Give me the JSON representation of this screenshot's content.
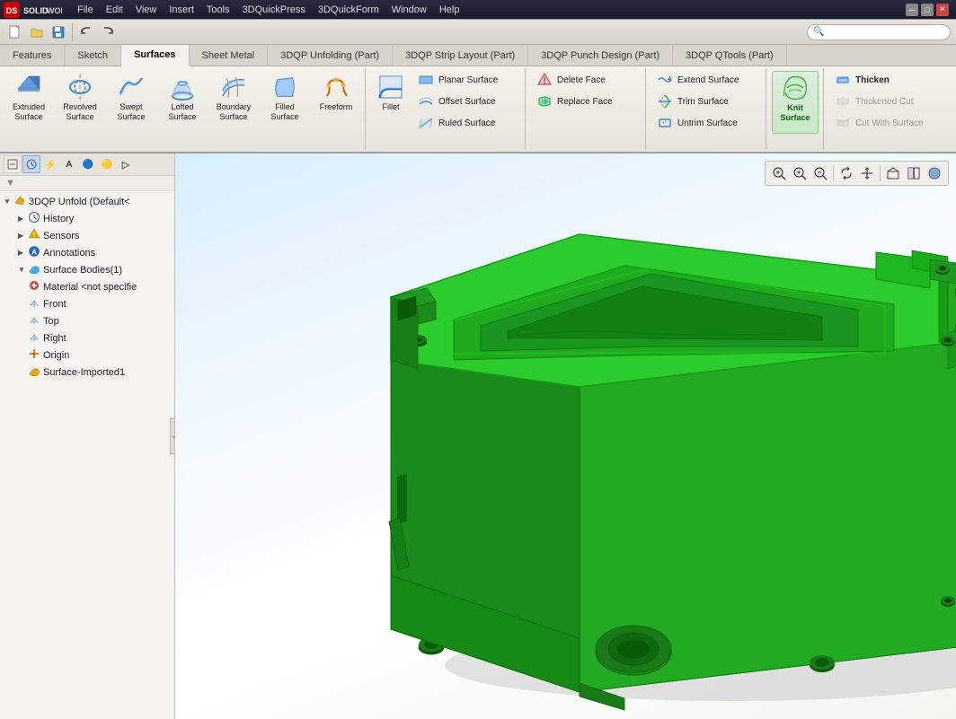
{
  "app": {
    "title": "SOLIDWORKS",
    "logo": "DS SOLIDWORKS"
  },
  "menubar": {
    "items": [
      "File",
      "Edit",
      "View",
      "Insert",
      "Tools",
      "3DQuickPress",
      "3DQuickForm",
      "Window",
      "Help"
    ]
  },
  "ribbon": {
    "tabs": [
      {
        "label": "Features",
        "active": false
      },
      {
        "label": "Sketch",
        "active": false
      },
      {
        "label": "Surfaces",
        "active": true
      },
      {
        "label": "Sheet Metal",
        "active": false
      },
      {
        "label": "3DQP Unfolding (Part)",
        "active": false
      },
      {
        "label": "3DQP Strip Layout (Part)",
        "active": false
      },
      {
        "label": "3DQP Punch Design (Part)",
        "active": false
      },
      {
        "label": "3DQP QTools (Part)",
        "active": false
      }
    ],
    "groups": {
      "surfaces": [
        {
          "id": "extruded",
          "label": "Extruded\nSurface",
          "icon": "extruded-surface-icon"
        },
        {
          "id": "revolved",
          "label": "Revolved\nSurface",
          "icon": "revolved-surface-icon"
        },
        {
          "id": "swept",
          "label": "Swept\nSurface",
          "icon": "swept-surface-icon"
        },
        {
          "id": "lofted",
          "label": "Lofted\nSurface",
          "icon": "lofted-surface-icon"
        },
        {
          "id": "boundary",
          "label": "Boundary\nSurface",
          "icon": "boundary-surface-icon"
        },
        {
          "id": "filled",
          "label": "Filled\nSurface",
          "icon": "filled-surface-icon"
        },
        {
          "id": "freeform",
          "label": "Freeform",
          "icon": "freeform-icon"
        }
      ],
      "modify": [
        {
          "id": "fillet",
          "label": "Fillet",
          "icon": "fillet-icon"
        },
        {
          "id": "planar",
          "label": "Planar Surface",
          "icon": "planar-surface-icon"
        },
        {
          "id": "offset",
          "label": "Offset Surface",
          "icon": "offset-surface-icon"
        },
        {
          "id": "ruled",
          "label": "Ruled Surface",
          "icon": "ruled-surface-icon"
        }
      ],
      "face": [
        {
          "id": "delete-face",
          "label": "Delete Face",
          "icon": "delete-face-icon"
        },
        {
          "id": "replace-face",
          "label": "Replace Face",
          "icon": "replace-face-icon"
        }
      ],
      "extend": [
        {
          "id": "extend-surface",
          "label": "Extend Surface",
          "icon": "extend-surface-icon"
        },
        {
          "id": "trim-surface",
          "label": "Trim Surface",
          "icon": "trim-surface-icon"
        },
        {
          "id": "untrim-surface",
          "label": "Untrim Surface",
          "icon": "untrim-surface-icon"
        }
      ],
      "knit": [
        {
          "id": "knit-surface",
          "label": "Knit\nSurface",
          "icon": "knit-surface-icon"
        }
      ],
      "thicken": [
        {
          "id": "thicken",
          "label": "Thicken",
          "icon": "thicken-icon"
        },
        {
          "id": "thickened-cut",
          "label": "Thickened Cut",
          "icon": "thickened-cut-icon"
        },
        {
          "id": "cut-with-surface",
          "label": "Cut With Surface",
          "icon": "cut-with-surface-icon"
        }
      ]
    }
  },
  "sidebar": {
    "toolbar_buttons": [
      "filter",
      "history",
      "sensors",
      "expand-all",
      "collapse-all",
      "more"
    ],
    "tree": [
      {
        "id": "root",
        "label": "3DQP Unfold  (Default<",
        "icon": "part-icon",
        "level": 0,
        "expandable": true
      },
      {
        "id": "history",
        "label": "History",
        "icon": "history-icon",
        "level": 1
      },
      {
        "id": "sensors",
        "label": "Sensors",
        "icon": "sensor-icon",
        "level": 1
      },
      {
        "id": "annotations",
        "label": "Annotations",
        "icon": "annotation-icon",
        "level": 1,
        "expandable": true
      },
      {
        "id": "surface-bodies",
        "label": "Surface Bodies(1)",
        "icon": "surface-bodies-icon",
        "level": 1,
        "expandable": true
      },
      {
        "id": "material",
        "label": "Material <not specifie",
        "icon": "material-icon",
        "level": 1
      },
      {
        "id": "front",
        "label": "Front",
        "icon": "plane-icon",
        "level": 1
      },
      {
        "id": "top",
        "label": "Top",
        "icon": "plane-icon",
        "level": 1
      },
      {
        "id": "right",
        "label": "Right",
        "icon": "plane-icon",
        "level": 1
      },
      {
        "id": "origin",
        "label": "Origin",
        "icon": "origin-icon",
        "level": 1
      },
      {
        "id": "surface-imported",
        "label": "Surface-Imported1",
        "icon": "surface-icon",
        "level": 1
      }
    ]
  },
  "viewport": {
    "view_buttons": [
      "zoom-to-fit",
      "zoom-in",
      "zoom-out",
      "rotate",
      "pan",
      "view-orient",
      "section-view",
      "appearance",
      "settings"
    ]
  }
}
